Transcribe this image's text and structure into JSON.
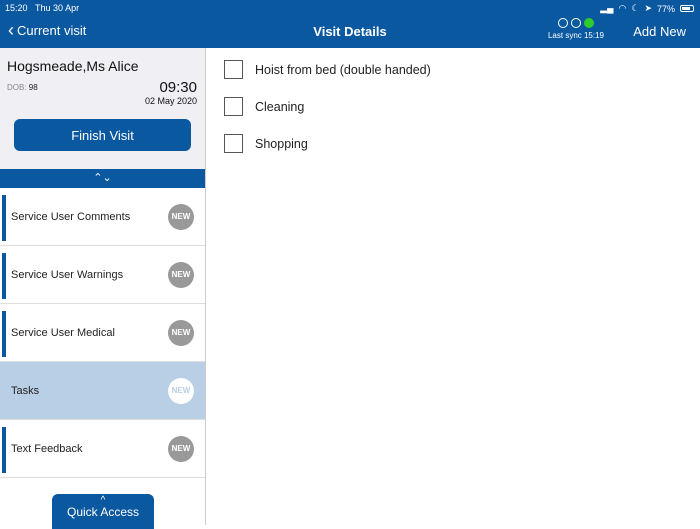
{
  "status": {
    "time": "15:20",
    "date": "Thu 30 Apr",
    "battery": "77%"
  },
  "nav": {
    "back": "Current visit",
    "title": "Visit Details",
    "sync": "Last sync 15:19",
    "add_new": "Add New"
  },
  "patient": {
    "name": "Hogsmeade,Ms Alice",
    "dob_label": "DOB:",
    "dob": "98",
    "time": "09:30",
    "date": "02 May 2020",
    "finish": "Finish Visit"
  },
  "menu": [
    {
      "label": "Service User Comments",
      "badge": "NEW"
    },
    {
      "label": "Service User Warnings",
      "badge": "NEW"
    },
    {
      "label": "Service User Medical",
      "badge": "NEW"
    },
    {
      "label": "Tasks",
      "badge": "NEW",
      "selected": true
    },
    {
      "label": "Text Feedback",
      "badge": "NEW"
    }
  ],
  "quick_access": "Quick Access",
  "tasks": [
    {
      "label": "Hoist from bed (double handed)",
      "checked": false
    },
    {
      "label": "Cleaning",
      "checked": false
    },
    {
      "label": "Shopping",
      "checked": false
    }
  ]
}
